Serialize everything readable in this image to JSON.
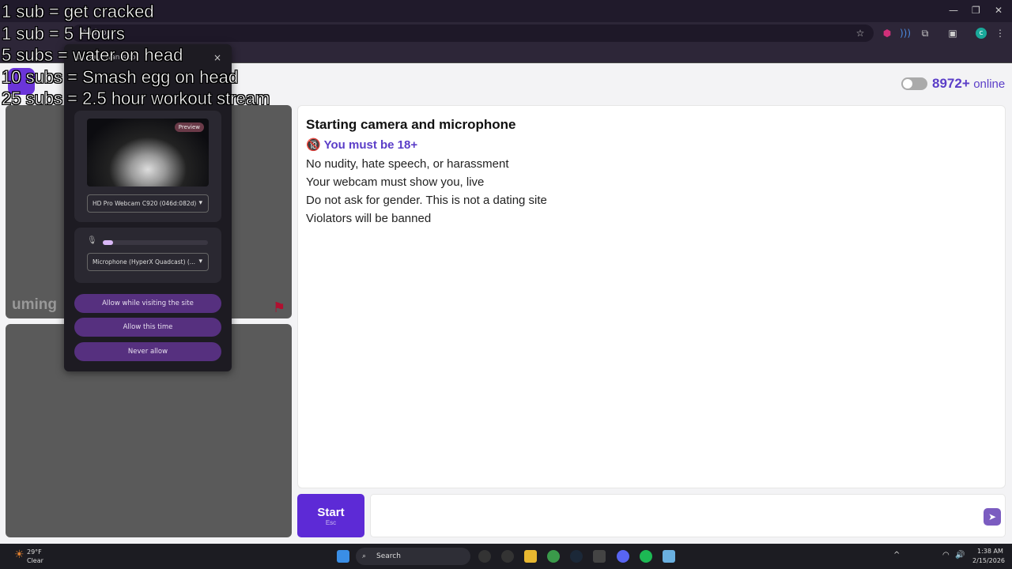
{
  "browser": {
    "url": "/video/",
    "window_controls": [
      "minimize",
      "restore",
      "close"
    ],
    "extensions": [
      "ublock-icon",
      "audio-icon",
      "puzzle-icon",
      "search-tab-icon"
    ],
    "profile_initial": "c"
  },
  "header": {
    "online_count": "8972+",
    "online_label": "online",
    "toggle_on": false
  },
  "left": {
    "watermark": "uming"
  },
  "panel": {
    "title": "Starting camera and microphone",
    "age_icon": "🔞",
    "age_warning": "You must be 18+",
    "rules": [
      "No nudity, hate speech, or harassment",
      "Your webcam must show you, live",
      "Do not ask for gender. This is not a dating site",
      "Violators will be banned"
    ]
  },
  "bottom": {
    "start_label": "Start",
    "start_hint": "Esc",
    "chat_placeholder": ""
  },
  "popup": {
    "title": "uming... wants to",
    "close": "×",
    "preview_label": "Preview",
    "camera": "HD Pro Webcam C920 (046d:082d)",
    "microphone": "Microphone (HyperX Quadcast) (...",
    "mic_level_percent": 10,
    "buttons": [
      "Allow while visiting the site",
      "Allow this time",
      "Never allow"
    ]
  },
  "overlay": [
    "1 sub = get cracked",
    "1 sub = 5 Hours",
    "5 subs = water on head",
    "10 subs = Smash egg on head",
    "25 subs = 2.5 hour workout stream"
  ],
  "taskbar": {
    "weather_temp": "29°F",
    "weather_desc": "Clear",
    "search": "Search",
    "time": "1:38 AM",
    "date": "2/15/2026"
  },
  "colors": {
    "accent": "#5b3ec8",
    "start": "#5d2ad6",
    "popup_button": "#56307f"
  }
}
